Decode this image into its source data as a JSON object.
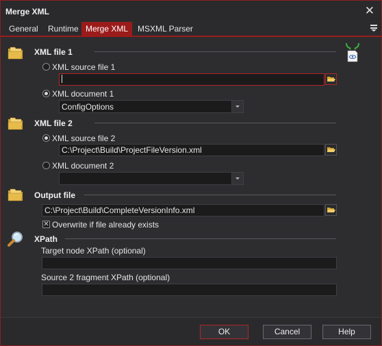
{
  "window": {
    "title": "Merge XML",
    "close_glyph": "✕"
  },
  "tabs": [
    {
      "label": "General"
    },
    {
      "label": "Runtime"
    },
    {
      "label": "Merge XML",
      "active": true
    },
    {
      "label": "MSXML Parser"
    }
  ],
  "xml_file_1": {
    "heading": "XML file 1",
    "source_radio_label": "XML source file 1",
    "source_value": "",
    "document_radio_label": "XML document 1",
    "document_value": "ConfigOptions",
    "selected": "document"
  },
  "xml_file_2": {
    "heading": "XML file 2",
    "source_radio_label": "XML source file 2",
    "source_value": "C:\\Project\\Build\\ProjectFileVersion.xml",
    "document_radio_label": "XML document 2",
    "document_value": "",
    "selected": "source"
  },
  "output_file": {
    "heading": "Output file",
    "value": "C:\\Project\\Build\\CompleteVersionInfo.xml",
    "overwrite_label": "Overwrite if file already exists",
    "overwrite_checked": true,
    "check_glyph": "✕"
  },
  "xpath": {
    "heading": "XPath",
    "target_label": "Target node XPath (optional)",
    "target_value": "",
    "fragment_label": "Source 2 fragment XPath (optional)",
    "fragment_value": ""
  },
  "buttons": {
    "ok": "OK",
    "cancel": "Cancel",
    "help": "Help"
  },
  "icons": {
    "folder": "folder-icon",
    "search": "magnifier-icon",
    "merge": "xml-merge-icon",
    "browse": "open-folder-icon",
    "menu": "hamburger-menu-icon"
  },
  "colors": {
    "accent": "#9b1b1b",
    "background": "#2d2d30",
    "field": "#1b1b1c"
  }
}
